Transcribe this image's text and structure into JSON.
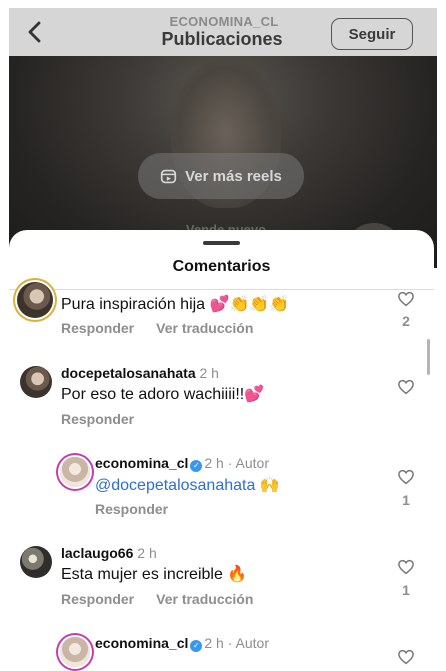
{
  "header": {
    "account": "ECONOMINA_CL",
    "title": "Publicaciones",
    "follow_label": "Seguir"
  },
  "reel": {
    "more_reels_label": "Ver más reels",
    "hint_text": "Vende nuevo"
  },
  "sheet": {
    "title": "Comentarios"
  },
  "comments": [
    {
      "username": "",
      "time": "",
      "author_label": "",
      "text": "Pura inspiración hija 💕👏👏👏",
      "reply_label": "Responder",
      "translate_label": "Ver traducción",
      "likes": "2"
    },
    {
      "username": "docepetalosanahata",
      "time": "2 h",
      "author_label": "",
      "text": "Por eso te adoro wachiiii!!💕",
      "reply_label": "Responder",
      "translate_label": "",
      "likes": ""
    },
    {
      "username": "economina_cl",
      "time": "2 h",
      "author_label": "Autor",
      "mention": "@docepetalosanahata",
      "text": "🙌",
      "reply_label": "Responder",
      "translate_label": "",
      "likes": "1"
    },
    {
      "username": "laclaugo66",
      "time": "2 h",
      "author_label": "",
      "text": "Esta mujer es increible 🔥",
      "reply_label": "Responder",
      "translate_label": "Ver traducción",
      "likes": "1"
    },
    {
      "username": "economina_cl",
      "time": "2 h",
      "author_label": "Autor",
      "text": "",
      "reply_label": "",
      "translate_label": "",
      "likes": ""
    }
  ],
  "icons": {
    "back": "chevron-left-icon",
    "reels": "reels-icon",
    "like": "heart-outline-icon",
    "verified": "verified-badge-icon"
  },
  "colors": {
    "mention": "#2d6fd3",
    "verified": "#3897f0",
    "muted_text": "#8e8e8e"
  }
}
